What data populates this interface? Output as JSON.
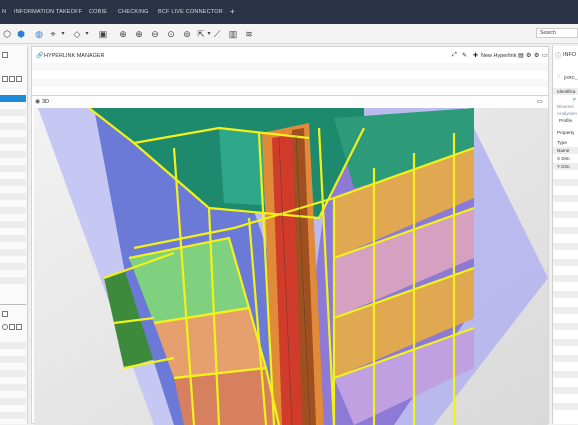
{
  "top_tabs": [
    "N",
    "INFORMATION TAKEOFF",
    "COBIE",
    "CHECKING",
    "BCF LIVE CONNECTOR",
    "+"
  ],
  "search": {
    "placeholder": "Search"
  },
  "hyperlink_manager": {
    "title": "HYPERLINK MANAGER",
    "new_hyperlink_label": "New Hyperlink"
  },
  "view3d": {
    "title": "3D"
  },
  "right_panel": {
    "title": "INFO",
    "object_name": "[ARC_",
    "identification_label": "Identifica",
    "dimension_label": "Dimensi",
    "analysis_label": "AnalysisA",
    "profile_label": "Profile",
    "property_label": "Property",
    "rows": [
      "Type",
      "Name",
      "X Dim.",
      "Y Dim."
    ]
  },
  "colors": {
    "topbar": "#2b3447",
    "accent_blue": "#1e8bd9",
    "model_yellow": "#f2f21a"
  }
}
